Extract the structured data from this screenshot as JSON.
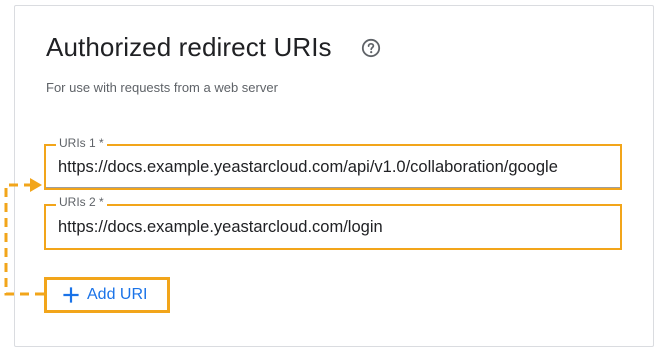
{
  "section": {
    "title": "Authorized redirect URIs",
    "subtitle": "For use with requests from a web server"
  },
  "icons": {
    "help": "help-circle-icon",
    "add": "plus-icon"
  },
  "uris": [
    {
      "label": "URIs 1 *",
      "value": "https://docs.example.yeastarcloud.com/api/v1.0/collaboration/google"
    },
    {
      "label": "URIs 2 *",
      "value": "https://docs.example.yeastarcloud.com/login"
    }
  ],
  "add_button": {
    "label": "Add URI"
  },
  "colors": {
    "highlight": "#f2a51a",
    "accent": "#1a73e8",
    "text": "#202124",
    "muted": "#5f6368"
  }
}
